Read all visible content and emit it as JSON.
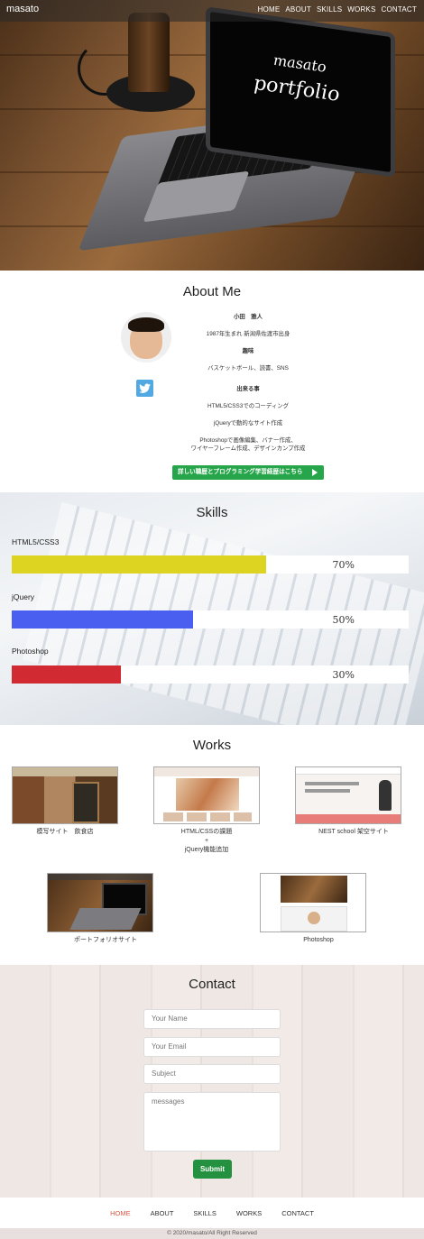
{
  "navbar": {
    "brand": "masato",
    "links": [
      "HOME",
      "ABOUT",
      "SKILLS",
      "WORKS",
      "CONTACT"
    ]
  },
  "hero": {
    "screen_line1": "masato",
    "screen_line2": "portfolio"
  },
  "about": {
    "title": "About Me",
    "name": "小田　雅人",
    "birth": "1987年生まれ 新潟県佐渡市出身",
    "hobby_heading": "趣味",
    "hobby": "バスケットボール、読書、SNS",
    "skills_heading": "出来る事",
    "skill1": "HTML5/CSS3でのコーディング",
    "skill2": "jQueryで動的なサイト作成",
    "skill3a": "Photoshopで画像編集、バナー作成、",
    "skill3b": "ワイヤーフレーム作成、デザインカンプ作成",
    "button": "詳しい職歴とプログラミング学習経歴はこちら",
    "twitter_icon": "twitter-icon"
  },
  "skills": {
    "title": "Skills",
    "items": [
      {
        "label": "HTML5/CSS3",
        "percent": 70,
        "percent_text": "70%",
        "color": "#dcd420"
      },
      {
        "label": "jQuery",
        "percent": 50,
        "percent_text": "50%",
        "color": "#4a5ef0"
      },
      {
        "label": "Photoshop",
        "percent": 30,
        "percent_text": "30%",
        "color": "#d12a33"
      }
    ]
  },
  "works": {
    "title": "Works",
    "items": [
      {
        "caption": "模写サイト　飲食店"
      },
      {
        "caption_l1": "HTML/CSSの課題",
        "caption_l2": "+",
        "caption_l3": "jQuery機能追加"
      },
      {
        "caption": "NEST school 架空サイト"
      },
      {
        "caption": "ポートフォリオサイト"
      },
      {
        "caption": "Photoshop"
      }
    ]
  },
  "contact": {
    "title": "Contact",
    "name_placeholder": "Your Name",
    "email_placeholder": "Your Email",
    "subject_placeholder": "Subject",
    "message_placeholder": "messages",
    "submit": "Submit"
  },
  "footer": {
    "links": [
      "HOME",
      "ABOUT",
      "SKILLS",
      "WORKS",
      "CONTACT"
    ],
    "copyright": "© 2020/masato/All Right Reserved"
  },
  "colors": {
    "accent_green": "#27a54a",
    "footer_active": "#e05a4a"
  }
}
